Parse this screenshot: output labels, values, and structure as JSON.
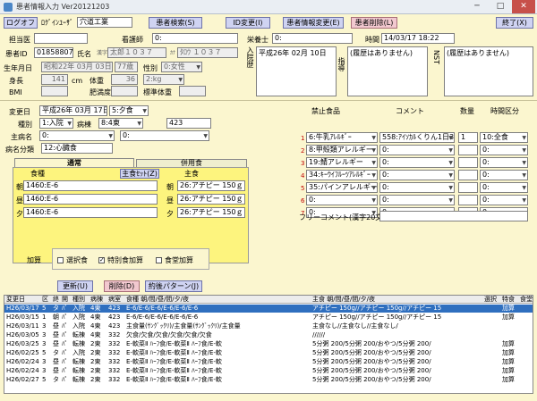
{
  "window": {
    "title": "患者情報入力 Ver20121203",
    "minimize": "─",
    "maximize": "□",
    "close": "✕"
  },
  "toolbar": {
    "logoff": "ログオフ",
    "user": "ﾛｸﾞｲﾝﾕｰｻﾞ",
    "org": "穴道工業",
    "search": "患者検索(S)",
    "id_change": "ID変更(I)",
    "info_change": "患者情報変更(E)",
    "delete": "患者削除(L)",
    "exit": "終了(X)"
  },
  "patient": {
    "doctor_label": "担当医",
    "ward_label": "看護師",
    "ward_value": "0:",
    "patient_id_label": "患者ID",
    "patient_id": "01858807",
    "name_label": "氏名",
    "name_kanji_tag": "漢字",
    "name_kanji": "太郎１０３７",
    "name_kana_tag": "ｶﾅ",
    "name_kana": "ﾀﾛｳ １０３７",
    "birth_label": "生年月日",
    "birth": "昭和22年 03月 03日",
    "age": "77歳",
    "sex_label": "性別",
    "sex": "0:女性",
    "height_label": "身長",
    "height": "141",
    "height_unit": "cm",
    "weight_label": "体重",
    "weight": "36",
    "weight_unit": "2:kg",
    "bmi_label": "BMI",
    "fat_label": "肥満度",
    "std_weight_label": "標準体重"
  },
  "nutritionist": {
    "label": "栄養士",
    "value": "0:",
    "time_label": "時間",
    "time": "14/03/17 18:22"
  },
  "history": {
    "label": "入院歴",
    "text": "平成26年 02月 10日",
    "guide_label": "指導",
    "guide_text": "(履歴はありません)",
    "nst_label": "NST",
    "nst_text": "(履歴はありません)"
  },
  "order": {
    "change_date_label": "変更日",
    "change_date": "平成26年 03月 17日",
    "meal_time": "5:夕食",
    "type_label": "種別",
    "type": "1:入院",
    "ward_label": "病棟",
    "ward": "8:4東",
    "room": "423",
    "disease_label": "主病名",
    "disease1": "0:",
    "disease2": "0:",
    "disease_class_label": "病名分類",
    "disease_class": "12:心臓食"
  },
  "tabs": {
    "normal": "通常",
    "combined": "併用食"
  },
  "meal": {
    "food_type_header": "食種",
    "staple_header": "主食",
    "food_set_button": "主食ｾｯﾄ(Z)",
    "staple_header2": "主食",
    "slot_labels": [
      "朝",
      "昼",
      "夕"
    ],
    "food_types": [
      "1460:E-6",
      "1460:E-6",
      "1460:E-6"
    ],
    "staples": [
      "26:アチピー 150ｇ",
      "26:アチピー 150ｇ",
      "26:アチピー 150ｇ"
    ]
  },
  "restrictions": {
    "food_header": "禁止食品",
    "comment_header": "コメント",
    "qty_header": "数量",
    "time_header": "時間区分",
    "nums": [
      "1",
      "2",
      "3",
      "4",
      "5",
      "6",
      "7"
    ],
    "foods": [
      "6:牛乳ｱﾚﾙｷﾞｰ",
      "8:甲殻類アレルギー",
      "19:鯖アレルギー",
      "34:ｷｰｳｲﾌﾙｰﾂｱﾚﾙｷﾞｰ",
      "35:パインアレルギー",
      "0:",
      "0:"
    ],
    "comments": [
      "558:ｱｲｿｶﾙくりん1日3ｷ",
      "0:",
      "0:",
      "0:",
      "0:",
      "0:",
      "0:"
    ],
    "qtys": [
      "1",
      "",
      "",
      "",
      "",
      "",
      ""
    ],
    "times": [
      "10:全食",
      "0:",
      "0:",
      "0:",
      "0:",
      "0:",
      "0:"
    ],
    "free_comment_label": "フリーコメント(漢字20文字)"
  },
  "addons": {
    "label": "加算",
    "options": [
      {
        "label": "選択食",
        "checked": false,
        "mark": ""
      },
      {
        "label": "特別食加算",
        "checked": true,
        "mark": "✓"
      },
      {
        "label": "食堂加算",
        "checked": false,
        "mark": ""
      }
    ]
  },
  "actions": {
    "update": "更新(U)",
    "delete": "削除(D)",
    "pattern": "約後パターン(J)"
  },
  "grid": {
    "headers": [
      "変更日",
      "区",
      "終",
      "開",
      "種別",
      "病棟",
      "病室",
      "食種 朝/間/昼/間/夕/夜",
      "主食 朝/間/昼/間/夕/夜",
      "選択",
      "特食",
      "食堂"
    ],
    "rows": [
      [
        "H26/03/17",
        "5",
        "タ",
        "ﾊﾟ",
        "入院",
        "4東",
        "423",
        "E-6/E-6/E-6/E-6/E-6/E-6",
        "アチピー 150g//アチピー 150g//アチピー 15",
        "",
        "加算",
        ""
      ],
      [
        "H26/03/15",
        "1",
        "朝",
        "ﾊﾟ",
        "入院",
        "4東",
        "423",
        "E-6/E-6/E-6/E-6/E-6/E-6",
        "アチピー 150g//アチピー 150g//アチピー 15",
        "",
        "加算",
        ""
      ],
      [
        "H26/03/11",
        "3",
        "昼",
        "ﾊﾟ",
        "入院",
        "4東",
        "423",
        "主食量(ｻﾝｸﾞｯｸﾘ)/主食量(ｻﾝｸﾞｯｸﾘ)/主食量",
        "主食なし//主食なし//主食なし/",
        "",
        "",
        ""
      ],
      [
        "H26/03/05",
        "3",
        "昼",
        "ﾊﾟ",
        "転棟",
        "4東",
        "332",
        "欠食/欠食/欠食/欠食/欠食/欠食",
        "//////",
        "",
        "",
        ""
      ],
      [
        "H26/03/25",
        "3",
        "昼",
        "ﾊﾟ",
        "転棟",
        "2東",
        "332",
        "E-軟菜Ⅱ ﾊｰﾌ食/E-軟菜Ⅱ ﾊｰﾌ食/E-軟",
        "5分粥 200/5分粥 200/おやつ/5分粥 200/",
        "",
        "加算",
        ""
      ],
      [
        "H26/02/25",
        "5",
        "タ",
        "ﾊﾟ",
        "入院",
        "2東",
        "332",
        "E-軟菜Ⅱ ﾊｰﾌ食/E-軟菜Ⅱ ﾊｰﾌ食/E-軟",
        "5分粥 200/5分粥 200/おやつ/5分粥 200/",
        "",
        "加算",
        ""
      ],
      [
        "H26/02/24",
        "3",
        "昼",
        "ﾊﾟ",
        "転棟",
        "2東",
        "332",
        "E-軟菜Ⅱ ﾊｰﾌ食/E-軟菜Ⅱ ﾊｰﾌ食/E-軟",
        "5分粥 200/5分粥 200/おやつ/5分粥 200/",
        "",
        "加算",
        ""
      ],
      [
        "H26/02/24",
        "3",
        "昼",
        "ﾊﾟ",
        "転棟",
        "2東",
        "332",
        "E-軟菜Ⅱ ﾊｰﾌ食/E-軟菜Ⅱ ﾊｰﾌ食/E-軟",
        "5分粥 200/5分粥 200/おやつ/5分粥 200/",
        "",
        "加算",
        ""
      ],
      [
        "H26/02/27",
        "5",
        "タ",
        "ﾊﾟ",
        "転棟",
        "2東",
        "332",
        "E-軟菜Ⅱ ﾊｰﾌ食/E-軟菜Ⅱ ﾊｰﾌ食/E-軟",
        "5分粥 200/5分粥 200/おやつ/5分粥 200/",
        "",
        "加算",
        ""
      ]
    ]
  }
}
